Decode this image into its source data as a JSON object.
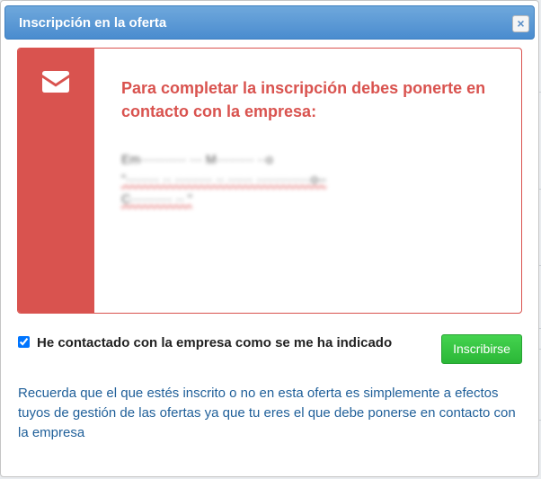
{
  "dialog": {
    "title": "Inscripción en la oferta",
    "close_label": "×"
  },
  "notice": {
    "icon": "envelope-icon",
    "heading": "Para completar la inscripción debes ponerte en contacto con la empresa:",
    "contact_lines": [
      "Em··········· ··· M········· ··o",
      "\"········ ·· ········· ·· ······ ·············o--",
      "C·········· ·· \""
    ],
    "accent_color": "#d9534f"
  },
  "confirm": {
    "checked": true,
    "label": "He contactado con la empresa como se me ha indicado"
  },
  "submit": {
    "label": "Inscribirse",
    "color": "#2ecc40"
  },
  "footer": {
    "text": "Recuerda que el que estés inscrito o no en esta oferta es simplemente a efectos tuyos de gestión de las ofertas ya que tu eres el que debe ponerse en contacto con la empresa"
  }
}
